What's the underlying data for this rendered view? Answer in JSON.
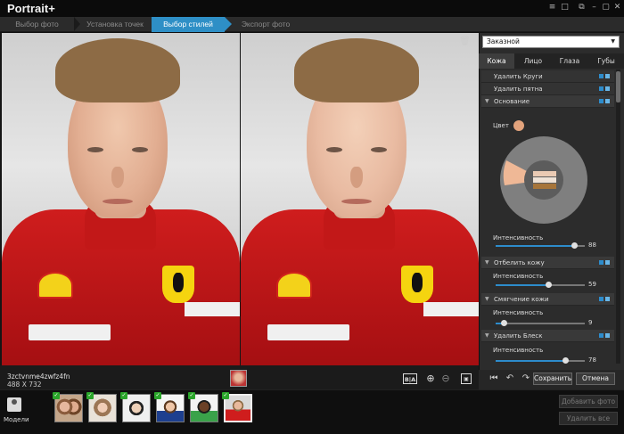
{
  "app": {
    "title": "Portrait+"
  },
  "window_controls": [
    "≡",
    "□",
    "⧉",
    "–",
    "▢",
    "✕"
  ],
  "steps": [
    {
      "label": "Выбор фото"
    },
    {
      "label": "Установка точек"
    },
    {
      "label": "Выбор стилей"
    },
    {
      "label": "Экспорт фото"
    }
  ],
  "photo_info": {
    "name": "3zctvnme4zwfz4fn",
    "dims": "488 X 732"
  },
  "tools": {
    "ba": "B|A",
    "zoom_in": "⊕",
    "zoom_out": "⊖",
    "fit": "▣"
  },
  "panel": {
    "preset": "Заказной",
    "tabs": [
      "Кожа",
      "Лицо",
      "Глаза",
      "Губы"
    ],
    "features": [
      {
        "label": "Удалить Круги",
        "section": false
      },
      {
        "label": "Удалить пятна",
        "section": false
      },
      {
        "label": "Основание",
        "section": true
      },
      {
        "label": "Отбелить кожу",
        "section": true
      },
      {
        "label": "Смягчение кожи",
        "section": true
      },
      {
        "label": "Удалить Блеск",
        "section": true
      }
    ],
    "color_label": "Цвет",
    "skin_color": "#e3a37c",
    "intensity_label": "Интенсивность",
    "intensities": [
      {
        "value": "88",
        "level": 0.88
      },
      {
        "value": "59",
        "level": 0.59
      },
      {
        "value": "9",
        "level": 0.09
      },
      {
        "value": "78",
        "level": 0.78
      }
    ],
    "footer": {
      "save": "Сохранить",
      "cancel": "Отмена"
    }
  },
  "bottom": {
    "models_label": "Модели",
    "add_photo": "Добавить фото",
    "remove_all": "Удалить все",
    "thumbs": [
      {
        "checked": true,
        "selected": false
      },
      {
        "checked": true,
        "selected": false
      },
      {
        "checked": true,
        "selected": false
      },
      {
        "checked": true,
        "selected": false
      },
      {
        "checked": true,
        "selected": false
      },
      {
        "checked": true,
        "selected": true
      }
    ]
  },
  "colors": {
    "accent": "#2e8fc6",
    "check": "#2aa52a",
    "suit_red": "#cf1d1d"
  }
}
